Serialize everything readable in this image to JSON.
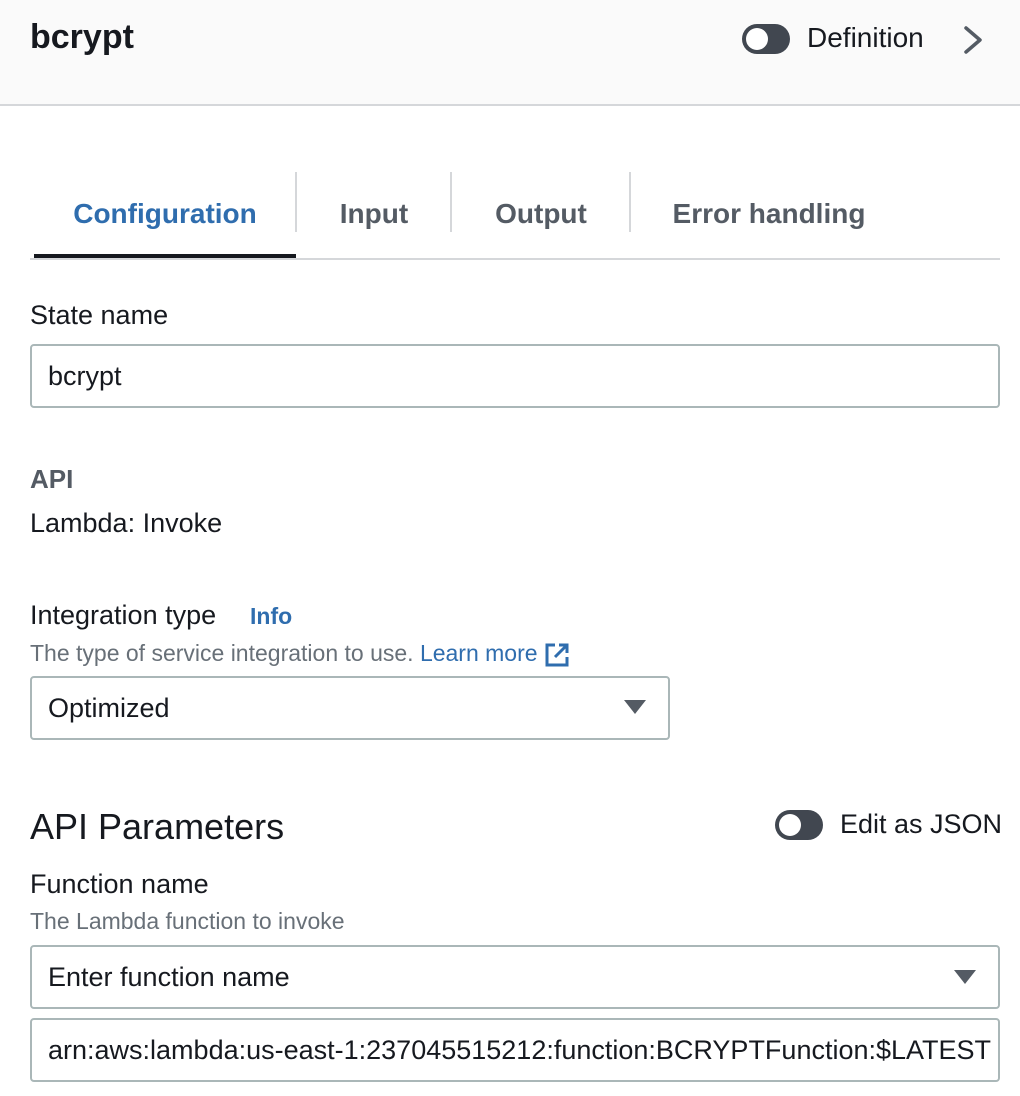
{
  "header": {
    "title": "bcrypt",
    "toggle_label": "Definition"
  },
  "tabs": [
    {
      "label": "Configuration",
      "active": true
    },
    {
      "label": "Input",
      "active": false
    },
    {
      "label": "Output",
      "active": false
    },
    {
      "label": "Error handling",
      "active": false
    }
  ],
  "state_name": {
    "label": "State name",
    "value": "bcrypt"
  },
  "api": {
    "label": "API",
    "value": "Lambda: Invoke"
  },
  "integration_type": {
    "label": "Integration type",
    "info": "Info",
    "description": "The type of service integration to use.",
    "learn_more": "Learn more",
    "selected": "Optimized"
  },
  "api_parameters": {
    "title": "API Parameters",
    "toggle_label": "Edit as JSON"
  },
  "function_name": {
    "label": "Function name",
    "description": "The Lambda function to invoke",
    "placeholder": "Enter function name",
    "arn_value": "arn:aws:lambda:us-east-1:237045515212:function:BCRYPTFunction:$LATEST"
  },
  "colors": {
    "accent": "#2f6dae",
    "text": "#16191f",
    "muted": "#687078",
    "toggle_off": "#414750"
  }
}
